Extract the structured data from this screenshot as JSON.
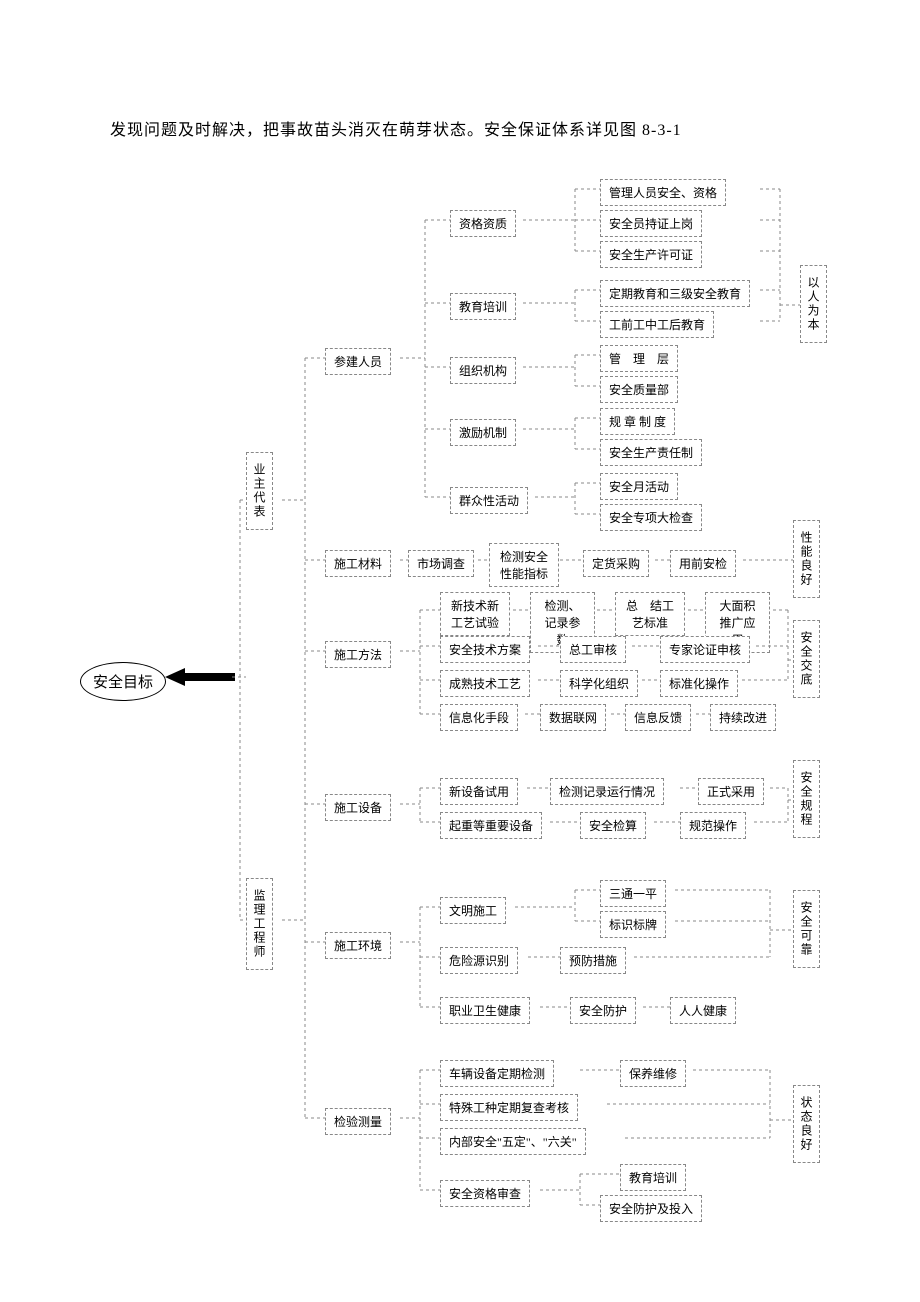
{
  "title": "发现问题及时解决，把事故苗头消灭在萌芽状态。安全保证体系详见图 8-3-1",
  "goal": "安全目标",
  "roles": {
    "owner": "业\n主\n代\n表",
    "supervisor": "监\n理\n工\n程\n师"
  },
  "categories": {
    "personnel": "参建人员",
    "materials": "施工材料",
    "methods": "施工方法",
    "equipment": "施工设备",
    "environment": "施工环境",
    "inspection": "检验测量"
  },
  "personnel": {
    "sub": {
      "qualification": "资格资质",
      "training": "教育培训",
      "org": "组织机构",
      "incentive": "激励机制",
      "mass": "群众性活动"
    },
    "qualification": [
      "管理人员安全、资格",
      "安全员持证上岗",
      "安全生产许可证"
    ],
    "training": [
      "定期教育和三级安全教育",
      "工前工中工后教育"
    ],
    "org": [
      "管　理　层",
      "安全质量部"
    ],
    "incentive": [
      "规 章 制 度",
      "安全生产责任制"
    ],
    "mass": [
      "安全月活动",
      "安全专项大检查"
    ]
  },
  "materials_flow": [
    "市场调查",
    "检测安全性能指标",
    "定货采购",
    "用前安检"
  ],
  "methods": {
    "row1": [
      "新技术新工艺试验",
      "检测、记录参数",
      "总　结工艺标准",
      "大面积推广应用"
    ],
    "row2": [
      "安全技术方案",
      "总工审核",
      "专家论证申核"
    ],
    "row3": [
      "成熟技术工艺",
      "科学化组织",
      "标准化操作"
    ],
    "row4": [
      "信息化手段",
      "数据联网",
      "信息反馈",
      "持续改进"
    ]
  },
  "equipment": {
    "row1": [
      "新设备试用",
      "检测记录运行情况",
      "正式采用"
    ],
    "row2": [
      "起重等重要设备",
      "安全检算",
      "规范操作"
    ]
  },
  "environment": {
    "civil": "文明施工",
    "civil_out": [
      "三通一平",
      "标识标牌"
    ],
    "hazard": "危险源识别",
    "hazard_out": "预防措施",
    "health": "职业卫生健康",
    "health_mid": "安全防护",
    "health_out": "人人健康"
  },
  "inspection": {
    "row1a": "车辆设备定期检测",
    "row1b": "保养维修",
    "row2": "特殊工种定期复查考核",
    "row3": "内部安全\"五定\"、\"六关\"",
    "row4": "安全资格审查",
    "row4_out": [
      "教育培训",
      "安全防护及投入"
    ]
  },
  "right_labels": {
    "people": "以\n人\n为\n本",
    "perf": "性\n能\n良\n好",
    "safety_disc": "安\n全\n交\n底",
    "safety_rules": "安\n全\n规\n程",
    "safe_reliable": "安\n全\n可\n靠",
    "status": "状\n态\n良\n好"
  }
}
